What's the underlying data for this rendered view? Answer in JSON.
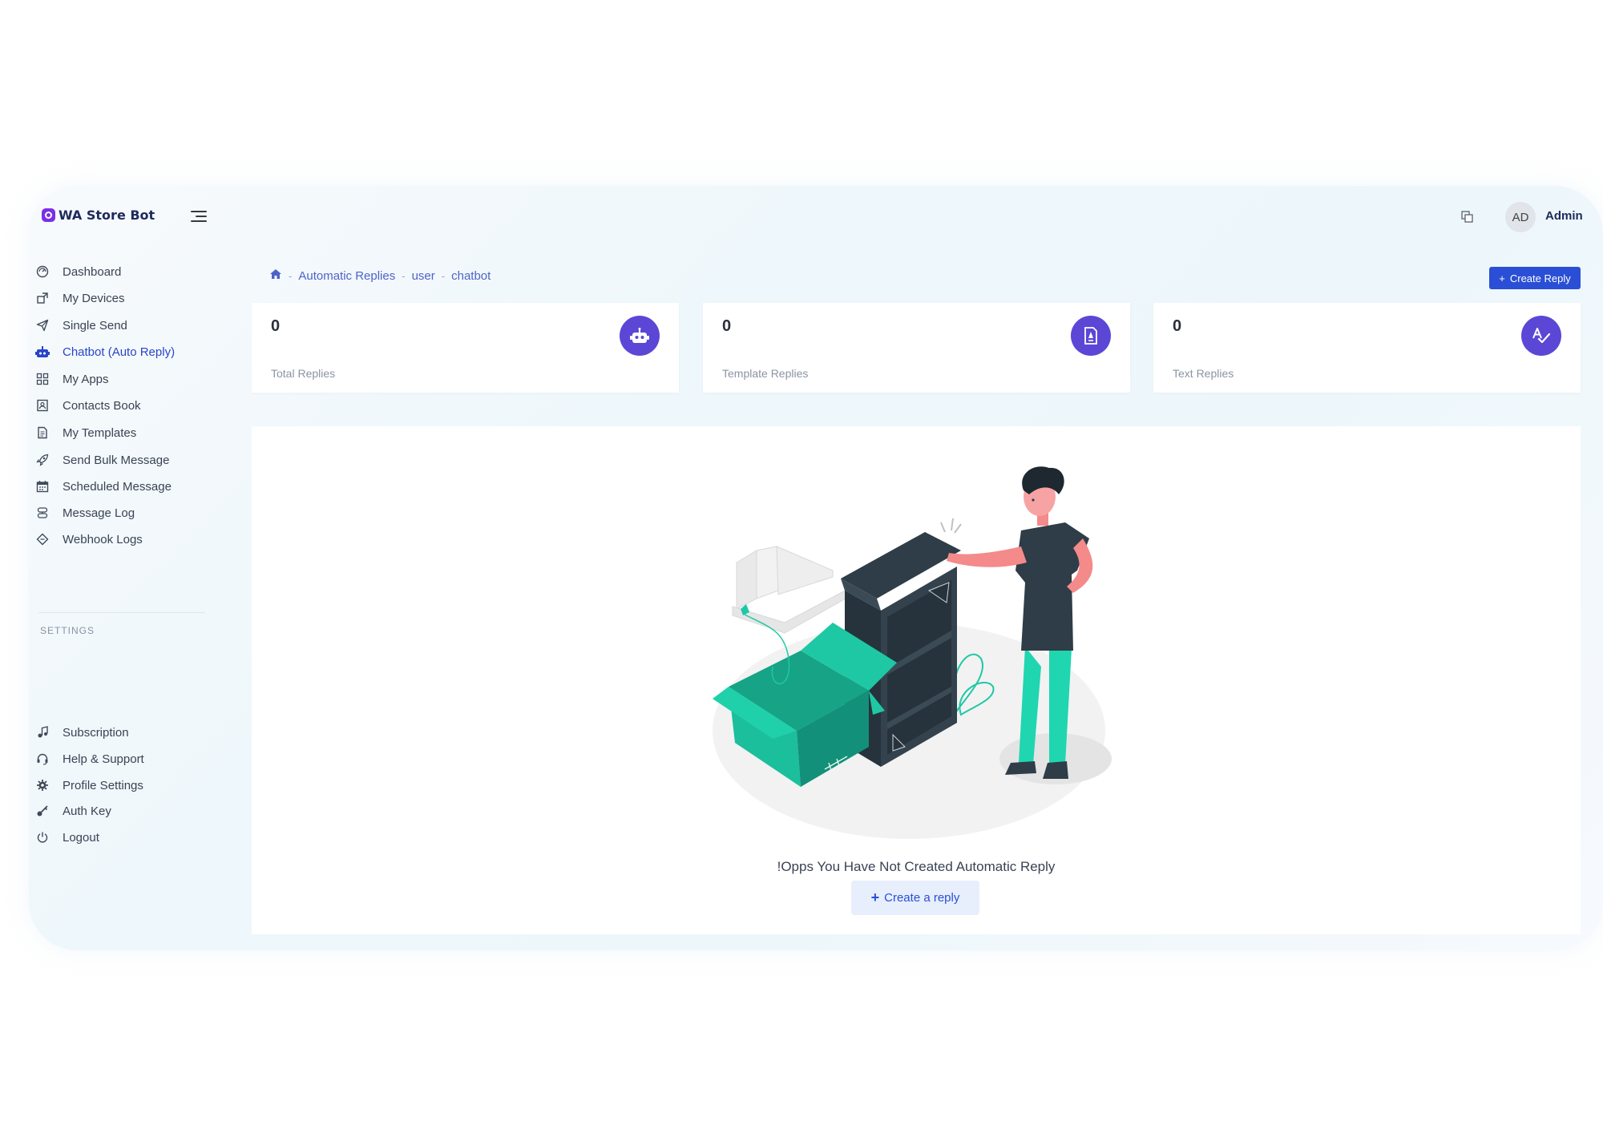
{
  "brand": {
    "name": "WA Store Bot"
  },
  "sidebar": {
    "items": [
      {
        "label": "Dashboard",
        "icon": "dashboard-icon"
      },
      {
        "label": "My Devices",
        "icon": "devices-icon"
      },
      {
        "label": "Single Send",
        "icon": "send-icon"
      },
      {
        "label": "Chatbot (Auto Reply)",
        "icon": "robot-icon",
        "active": true
      },
      {
        "label": "My Apps",
        "icon": "apps-icon"
      },
      {
        "label": "Contacts Book",
        "icon": "contacts-icon"
      },
      {
        "label": "My Templates",
        "icon": "template-icon"
      },
      {
        "label": "Send Bulk Message",
        "icon": "rocket-icon"
      },
      {
        "label": "Scheduled Message",
        "icon": "calendar-icon"
      },
      {
        "label": "Message Log",
        "icon": "log-icon"
      },
      {
        "label": "Webhook Logs",
        "icon": "webhook-icon"
      }
    ],
    "settings_label": "SETTINGS",
    "settings_items": [
      {
        "label": "Subscription",
        "icon": "subscription-icon"
      },
      {
        "label": "Help & Support",
        "icon": "headset-icon"
      },
      {
        "label": "Profile Settings",
        "icon": "gear-icon"
      },
      {
        "label": "Auth Key",
        "icon": "key-icon"
      },
      {
        "label": "Logout",
        "icon": "power-icon"
      }
    ]
  },
  "topbar": {
    "avatar_initials": "AD",
    "user_name": "Admin"
  },
  "breadcrumb": {
    "items": [
      "Automatic Replies",
      "user",
      "chatbot"
    ]
  },
  "header": {
    "create_button": "Create Reply"
  },
  "stats": [
    {
      "value": "0",
      "label": "Total Replies",
      "icon": "robot-icon"
    },
    {
      "value": "0",
      "label": "Template Replies",
      "icon": "file-icon"
    },
    {
      "value": "0",
      "label": "Text Replies",
      "icon": "spellcheck-icon"
    }
  ],
  "empty_state": {
    "message": "!Opps You Have Not Created Automatic Reply",
    "button_label": "Create a reply"
  },
  "colors": {
    "accent": "#2a4fd6",
    "stat_circle": "#5b47d6",
    "illustration_teal": "#1fc8a5",
    "illustration_dark": "#2e3d47"
  }
}
